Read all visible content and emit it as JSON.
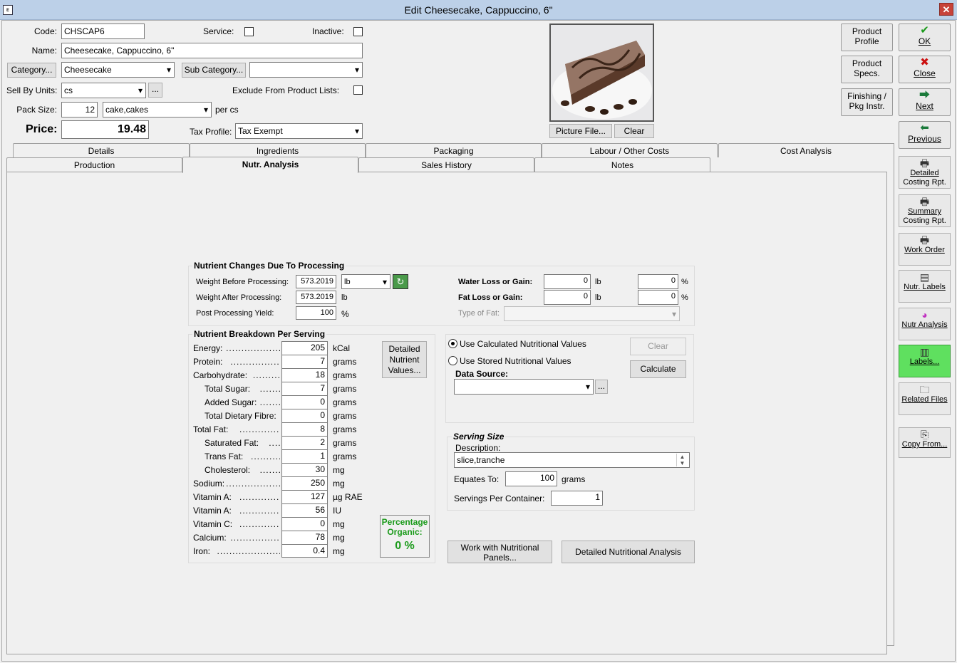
{
  "window": {
    "title": "Edit Cheesecake, Cappuccino, 6\"",
    "sys_icon": "ᴇ",
    "close": "✕"
  },
  "form": {
    "code_label": "Code:",
    "code": "CHSCAP6",
    "service_label": "Service:",
    "inactive_label": "Inactive:",
    "name_label": "Name:",
    "name": "Cheesecake, Cappuccino, 6\"",
    "category_btn": "Category...",
    "category": "Cheesecake",
    "subcategory_btn": "Sub Category...",
    "subcategory": "",
    "sell_units_label": "Sell By Units:",
    "sell_units": "cs",
    "ellipsis": "...",
    "exclude_label": "Exclude From Product Lists:",
    "pack_size_label": "Pack Size:",
    "pack_size": "12",
    "pack_unit": "cake,cakes",
    "per_cs": "per cs",
    "price_label": "Price:",
    "price": "19.48",
    "tax_label": "Tax Profile:",
    "tax_profile": "Tax Exempt",
    "picture_btn": "Picture File...",
    "clear_btn": "Clear"
  },
  "top_buttons": {
    "product_profile": [
      "Product",
      "Profile"
    ],
    "product_specs": [
      "Product",
      "Specs."
    ],
    "finishing": [
      "Finishing /",
      "Pkg Instr."
    ]
  },
  "side_buttons": [
    {
      "icon": "check-icon",
      "glyph": "✔",
      "label": "OK",
      "color": "#1a9a1a"
    },
    {
      "icon": "close-icon",
      "glyph": "✖",
      "label": "Close",
      "color": "#cc1111"
    },
    {
      "icon": "next-icon",
      "glyph": "⮕",
      "label": "Next",
      "color": "#1a7a3a"
    },
    {
      "icon": "previous-icon",
      "glyph": "⬅",
      "label": "Previous",
      "color": "#1a7a3a"
    }
  ],
  "report_buttons": [
    {
      "icon": "printer-icon",
      "label": [
        "Detailed",
        "Costing Rpt."
      ]
    },
    {
      "icon": "printer-icon",
      "label": [
        "Summary",
        "Costing Rpt."
      ]
    },
    {
      "icon": "printer-icon",
      "label": [
        "Work Order"
      ]
    },
    {
      "icon": "nutrition-label-icon",
      "label": [
        "Nutr. Labels"
      ]
    },
    {
      "icon": "pie-chart-icon",
      "label": [
        "Nutr Analysis"
      ]
    },
    {
      "icon": "barcode-icon",
      "label": [
        "Labels..."
      ]
    },
    {
      "icon": "folder-icon",
      "label": [
        "Related Files"
      ]
    },
    {
      "icon": "copy-icon",
      "label": [
        "Copy From..."
      ]
    }
  ],
  "tabs_row1": [
    "Details",
    "Ingredients",
    "Packaging",
    "Labour / Other Costs",
    "Cost Analysis"
  ],
  "tabs_row2": [
    "Production",
    "Nutr. Analysis",
    "Sales History",
    "Notes"
  ],
  "processing": {
    "title": "Nutrient Changes Due To Processing",
    "wb_label": "Weight Before Processing:",
    "wb": "573.2019",
    "wb_unit": "lb",
    "wa_label": "Weight After Processing:",
    "wa": "573.2019",
    "wa_unit": "lb",
    "yield_label": "Post Processing Yield:",
    "yield": "100",
    "pct": "%",
    "water_label": "Water Loss or Gain:",
    "water_lb": "0",
    "water_pct": "0",
    "fat_label": "Fat Loss or Gain:",
    "fat_lb": "0",
    "fat_pct": "0",
    "type_fat_label": "Type of Fat:",
    "lb": "lb"
  },
  "breakdown": {
    "title": "Nutrient Breakdown Per Serving",
    "rows": [
      {
        "label": "Energy:",
        "value": "205",
        "unit": "kCal",
        "indent": 0
      },
      {
        "label": "Protein:",
        "value": "7",
        "unit": "grams",
        "indent": 0
      },
      {
        "label": "Carbohydrate:",
        "value": "18",
        "unit": "grams",
        "indent": 0
      },
      {
        "label": "Total Sugar:",
        "value": "7",
        "unit": "grams",
        "indent": 1
      },
      {
        "label": "Added Sugar:",
        "value": "0",
        "unit": "grams",
        "indent": 1
      },
      {
        "label": "Total Dietary Fibre:",
        "value": "0",
        "unit": "grams",
        "indent": 1
      },
      {
        "label": "Total Fat:",
        "value": "8",
        "unit": "grams",
        "indent": 0
      },
      {
        "label": "Saturated Fat:",
        "value": "2",
        "unit": "grams",
        "indent": 1
      },
      {
        "label": "Trans Fat:",
        "value": "1",
        "unit": "grams",
        "indent": 1
      },
      {
        "label": "Cholesterol:",
        "value": "30",
        "unit": "mg",
        "indent": 1
      },
      {
        "label": "Sodium:",
        "value": "250",
        "unit": "mg",
        "indent": 0
      },
      {
        "label": "Vitamin A:",
        "value": "127",
        "unit": "µg RAE",
        "indent": 0
      },
      {
        "label": "Vitamin A:",
        "value": "56",
        "unit": "IU",
        "indent": 0
      },
      {
        "label": "Vitamin C:",
        "value": "0",
        "unit": "mg",
        "indent": 0
      },
      {
        "label": "Calcium:",
        "value": "78",
        "unit": "mg",
        "indent": 0
      },
      {
        "label": "Iron:",
        "value": "0.4",
        "unit": "mg",
        "indent": 0
      }
    ],
    "detailed_btn": [
      "Detailed",
      "Nutrient",
      "Values..."
    ],
    "organic_label": [
      "Percentage",
      "Organic:"
    ],
    "organic_value": "0 %"
  },
  "source": {
    "use_calc": "Use Calculated Nutritional Values",
    "use_stored": "Use Stored Nutritional Values",
    "data_source_label": "Data Source:",
    "clear_btn": "Clear",
    "calculate_btn": "Calculate"
  },
  "serving": {
    "title": "Serving Size",
    "desc_label": "Description:",
    "desc": "slice,tranche",
    "equates_label": "Equates To:",
    "equates": "100",
    "equates_unit": "grams",
    "per_container_label": "Servings Per Container:",
    "per_container": "1"
  },
  "bottom": {
    "panels_btn": [
      "Work with Nutritional",
      "Panels..."
    ],
    "analysis_btn": "Detailed Nutritional Analysis"
  },
  "colors": {
    "organic": "#1a9a1a",
    "labels_btn": "#5fe05f"
  }
}
